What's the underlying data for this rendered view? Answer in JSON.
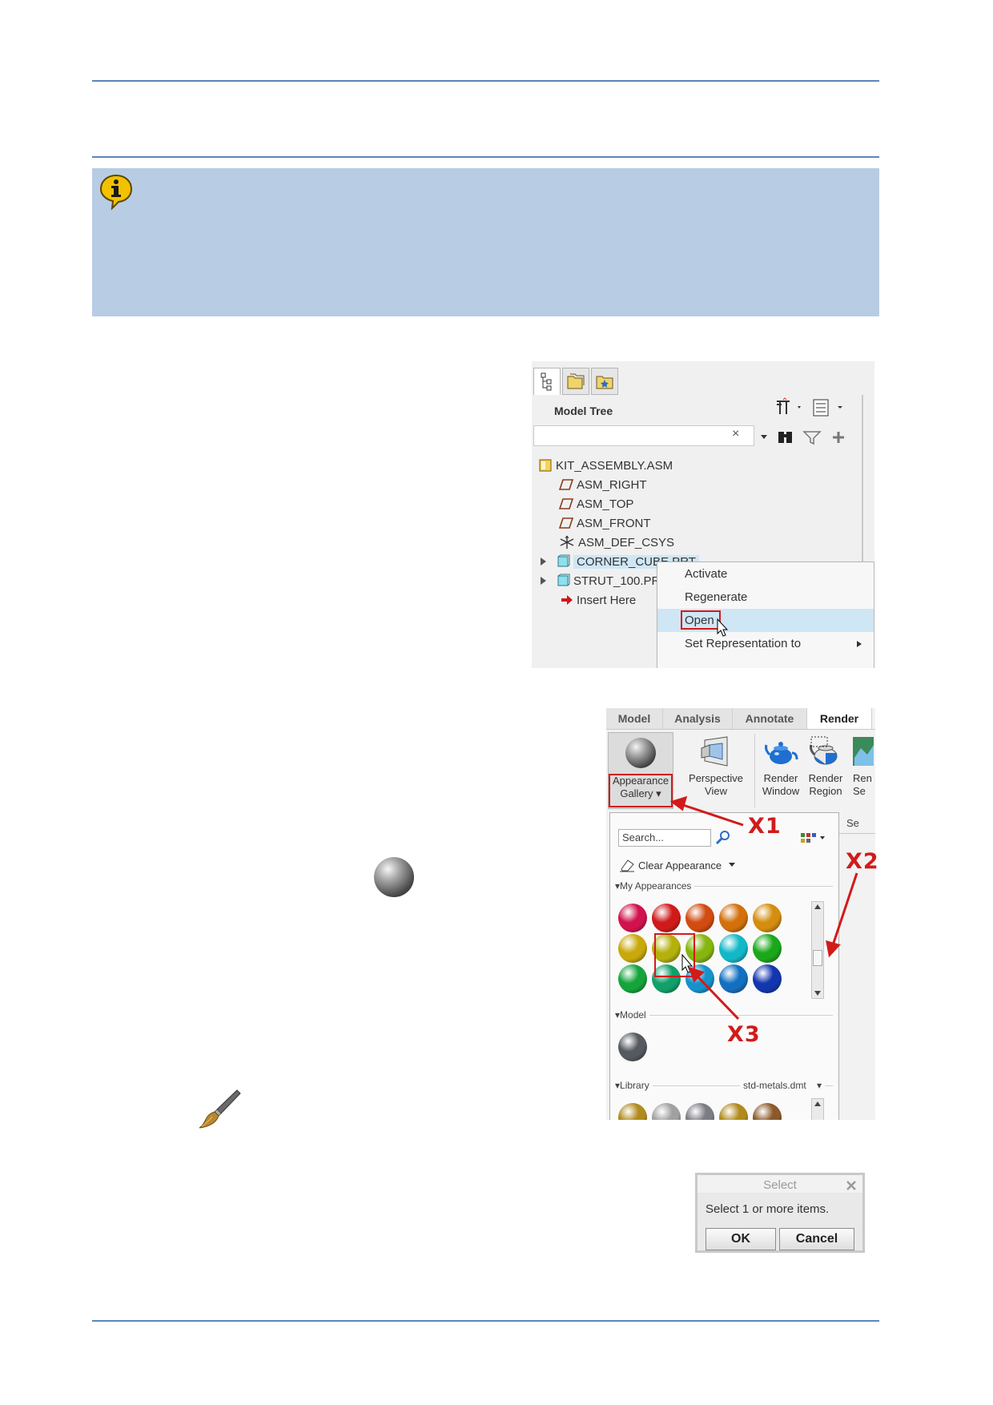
{
  "model_tree": {
    "title": "Model Tree",
    "search_clear": "×",
    "items": [
      {
        "label": "KIT_ASSEMBLY.ASM"
      },
      {
        "label": "ASM_RIGHT"
      },
      {
        "label": "ASM_TOP"
      },
      {
        "label": "ASM_FRONT"
      },
      {
        "label": "ASM_DEF_CSYS"
      },
      {
        "label": "CORNER_CUBE.PRT"
      },
      {
        "label": "STRUT_100.PRT"
      },
      {
        "label": "Insert Here"
      }
    ],
    "context_menu": [
      {
        "label": "Activate"
      },
      {
        "label": "Regenerate"
      },
      {
        "label": "Open"
      },
      {
        "label": "Set Representation to"
      }
    ]
  },
  "ribbon": {
    "tabs": [
      {
        "label": "Model"
      },
      {
        "label": "Analysis"
      },
      {
        "label": "Annotate"
      },
      {
        "label": "Render"
      }
    ],
    "buttons": [
      {
        "line1": "Appearance",
        "line2": "Gallery ▾"
      },
      {
        "line1": "Perspective",
        "line2": "View"
      },
      {
        "line1": "Render",
        "line2": "Window"
      },
      {
        "line1": "Render",
        "line2": "Region"
      },
      {
        "line1": "Ren",
        "line2": "Se"
      }
    ],
    "next_row_label": "Se"
  },
  "gallery": {
    "search_placeholder": "Search...",
    "clear_appearance": "Clear Appearance",
    "my_appearances_label": "My Appearances",
    "model_label": "Model",
    "library_label": "Library",
    "library_file": "std-metals.dmt",
    "my_colors": [
      "#d1124e",
      "#d01a1a",
      "#d24b10",
      "#d3700c",
      "#d48d0e",
      "#c9a80a",
      "#b4b00c",
      "#86b510",
      "#13b8c8",
      "#1aa81a",
      "#14a43a",
      "#12a06a",
      "#1592cc",
      "#1370c0",
      "#1236b0"
    ],
    "model_colors": [
      "#555a60"
    ],
    "library_colors": [
      "#b08a1c",
      "#a0a0a0",
      "#7c7c84",
      "#b08a1c",
      "#8a5a2a"
    ]
  },
  "select_dialog": {
    "title": "Select",
    "message": "Select 1 or more items.",
    "ok": "OK",
    "cancel": "Cancel"
  },
  "callouts": {
    "x1": "X1",
    "x2": "X2",
    "x3": "X3"
  }
}
